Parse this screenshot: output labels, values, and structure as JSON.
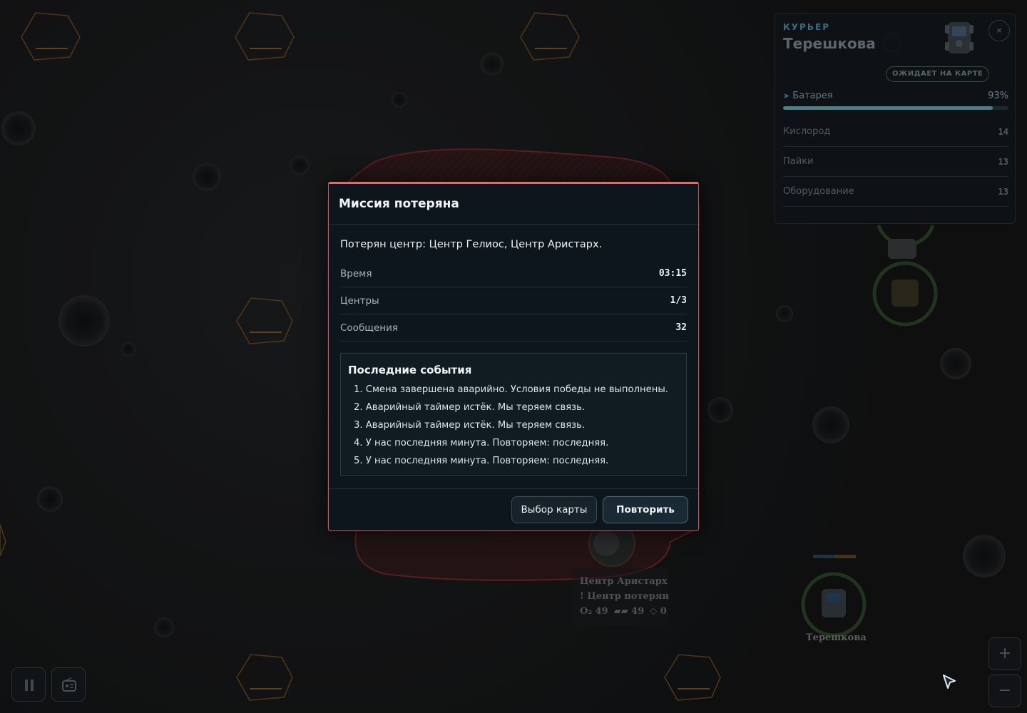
{
  "map": {
    "center_labels": [
      "Центр Аристарх",
      "! Центр потерян",
      "O₂ 49",
      "▰▰ 49",
      "◇ 0"
    ],
    "rover_label": "Терешкова"
  },
  "courier": {
    "role": "КУРЬЕР",
    "name": "Терешкова",
    "close_icon": "×",
    "status": "ОЖИДАЕТ НА КАРТЕ",
    "battery_label": "Батарея",
    "battery_value": "93%",
    "battery_fraction": 0.93,
    "stats": [
      {
        "label": "Кислород",
        "value": "14"
      },
      {
        "label": "Пайки",
        "value": "13"
      },
      {
        "label": "Оборудование",
        "value": "13"
      }
    ]
  },
  "controls": {
    "zoom_in": "+",
    "zoom_out": "−"
  },
  "modal": {
    "title": "Миссия потеряна",
    "lost_text": "Потерян центр: Центр Гелиос, Центр Аристарх.",
    "stats": [
      {
        "label": "Время",
        "value": "03:15"
      },
      {
        "label": "Центры",
        "value": "1/3"
      },
      {
        "label": "Сообщения",
        "value": "32"
      }
    ],
    "events_title": "Последние события",
    "events": [
      "1. Смена завершена аварийно. Условия победы не выполнены.",
      "2. Аварийный таймер истёк. Мы теряем связь.",
      "3. Аварийный таймер истёк. Мы теряем связь.",
      "4. У нас последняя минута. Повторяем: последняя.",
      "5. У нас последняя минута. Повторяем: последняя."
    ],
    "map_select_label": "Выбор карты",
    "retry_label": "Повторить"
  },
  "colors": {
    "accent_danger": "#e06a6e",
    "modal_bg": "#0d161c",
    "zone_red": "#7a2a2c",
    "hex_outline": "#6b4a1e",
    "ring_green": "#2f4a2a"
  }
}
